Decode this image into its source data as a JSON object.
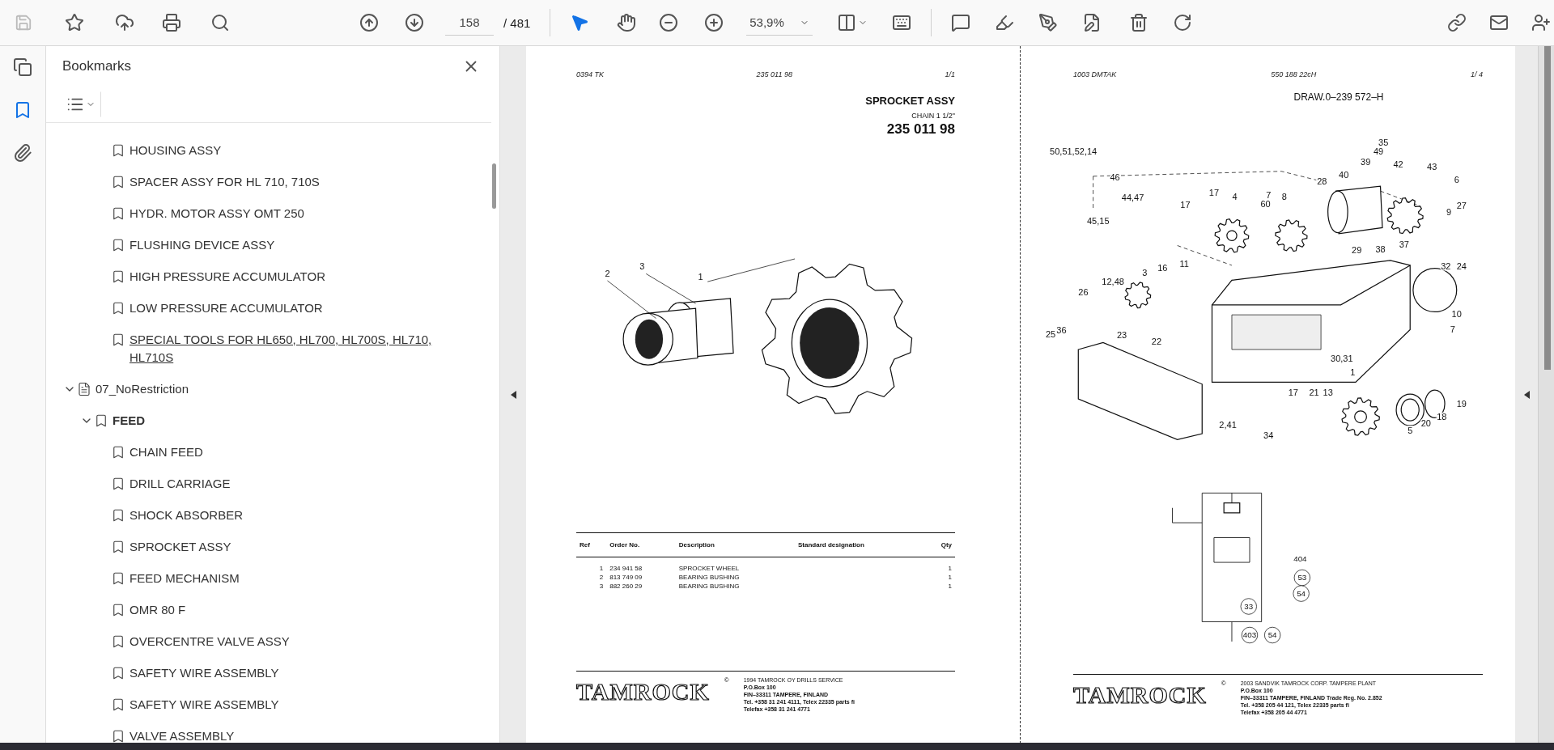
{
  "toolbar": {
    "page_number": "158",
    "page_total": "/ 481",
    "zoom": "53,9%",
    "tools": [
      {
        "kind": "select",
        "selected": true
      },
      {
        "kind": "hand",
        "selected": false
      }
    ]
  },
  "side_rail": [
    {
      "kind": "pages",
      "selected": false
    },
    {
      "kind": "bookmarks",
      "selected": true
    },
    {
      "kind": "attachments",
      "selected": false
    }
  ],
  "bookmarks": {
    "title": "Bookmarks",
    "earlier_items": [
      {
        "label": "HOUSING ASSY",
        "hovered": false
      },
      {
        "label": "SPACER ASSY FOR HL 710, 710S",
        "hovered": false
      },
      {
        "label": "HYDR. MOTOR ASSY OMT 250",
        "hovered": false
      },
      {
        "label": "FLUSHING DEVICE ASSY",
        "hovered": false
      },
      {
        "label": "HIGH PRESSURE ACCUMULATOR",
        "hovered": false
      },
      {
        "label": "LOW PRESSURE ACCUMULATOR",
        "hovered": false
      },
      {
        "label": "SPECIAL TOOLS FOR HL650, HL700, HL700S, HL710, HL710S",
        "hovered": true
      }
    ],
    "tree": [
      {
        "label": "07_NoRestriction",
        "kind": "folder",
        "expanded": true,
        "hovered": false,
        "children": [
          {
            "label": "FEED",
            "kind": "bookmark",
            "expanded": true,
            "hovered": false,
            "children": [
              {
                "label": "CHAIN FEED",
                "hovered": false
              },
              {
                "label": "DRILL CARRIAGE",
                "hovered": false
              },
              {
                "label": "SHOCK ABSORBER",
                "hovered": false
              },
              {
                "label": "SPROCKET ASSY",
                "hovered": false
              },
              {
                "label": "FEED MECHANISM",
                "hovered": false
              },
              {
                "label": "OMR 80 F",
                "hovered": false
              },
              {
                "label": "OVERCENTRE VALVE ASSY",
                "hovered": false
              },
              {
                "label": "SAFETY WIRE ASSEMBLY",
                "hovered": false
              },
              {
                "label": "SAFETY WIRE ASSEMBLY",
                "hovered": false
              },
              {
                "label": "VALVE ASSEMBLY",
                "hovered": false
              }
            ]
          }
        ]
      }
    ]
  },
  "pages": [
    {
      "header": [
        "0394  TK",
        "235 011 98",
        "1/1"
      ],
      "title": "SPROCKET ASSY",
      "subtitle": "CHAIN 1 1/2\"",
      "part_number": "235 011 98",
      "callouts": [
        "2",
        "3",
        "1"
      ],
      "table": {
        "columns": [
          "Ref",
          "Order No.",
          "Description",
          "Standard designation",
          "Qty"
        ],
        "rows": [
          [
            "1",
            "234 941 58",
            "SPROCKET WHEEL",
            "",
            "1"
          ],
          [
            "2",
            "813 749 09",
            "BEARING BUSHING",
            "",
            "1"
          ],
          [
            "3",
            "882 260 29",
            "BEARING BUSHING",
            "",
            "1"
          ]
        ]
      },
      "footer": {
        "logo": "TAMROCK",
        "copyright": "©",
        "lines": [
          "1994  TAMROCK OY DRILLS SERVICE",
          "P.O.Box 100",
          "FIN–33311 TAMPERE, FINLAND",
          "Tel. +358 31 241 4111, Telex 22335 parts fi",
          "Telefax +358 31 241 4771"
        ]
      }
    },
    {
      "header": [
        "1003  DMTAK",
        "550 188 22cH",
        "1/  4"
      ],
      "title": "DRAW.0–239 572–H",
      "callouts": [
        "50,51,52,14",
        "46",
        "44,47",
        "45,15",
        "35",
        "49",
        "39",
        "42",
        "43",
        "40",
        "28",
        "6",
        "17",
        "4",
        "7",
        "17",
        "60",
        "8",
        "9",
        "27",
        "38",
        "37",
        "29",
        "32",
        "24",
        "3",
        "16",
        "11",
        "12,48",
        "26",
        "10",
        "7",
        "25",
        "36",
        "23",
        "22",
        "30,31",
        "1",
        "17",
        "21",
        "13",
        "19",
        "18",
        "20",
        "5",
        "2,41",
        "34"
      ],
      "schematic_labels": [
        "404",
        "53",
        "54",
        "33",
        "403",
        "54"
      ],
      "footer": {
        "logo": "TAMROCK",
        "copyright": "©",
        "lines": [
          "2003  SANDVIK TAMROCK CORP. TAMPERE PLANT",
          "P.O.Box 100",
          "FIN–33311 TAMPERE, FINLAND   Trade Reg. No. 2.852",
          "Tel. +358 205 44 121, Telex 22335 parts fi",
          "Telefax +358 205 44 4771"
        ]
      }
    }
  ]
}
